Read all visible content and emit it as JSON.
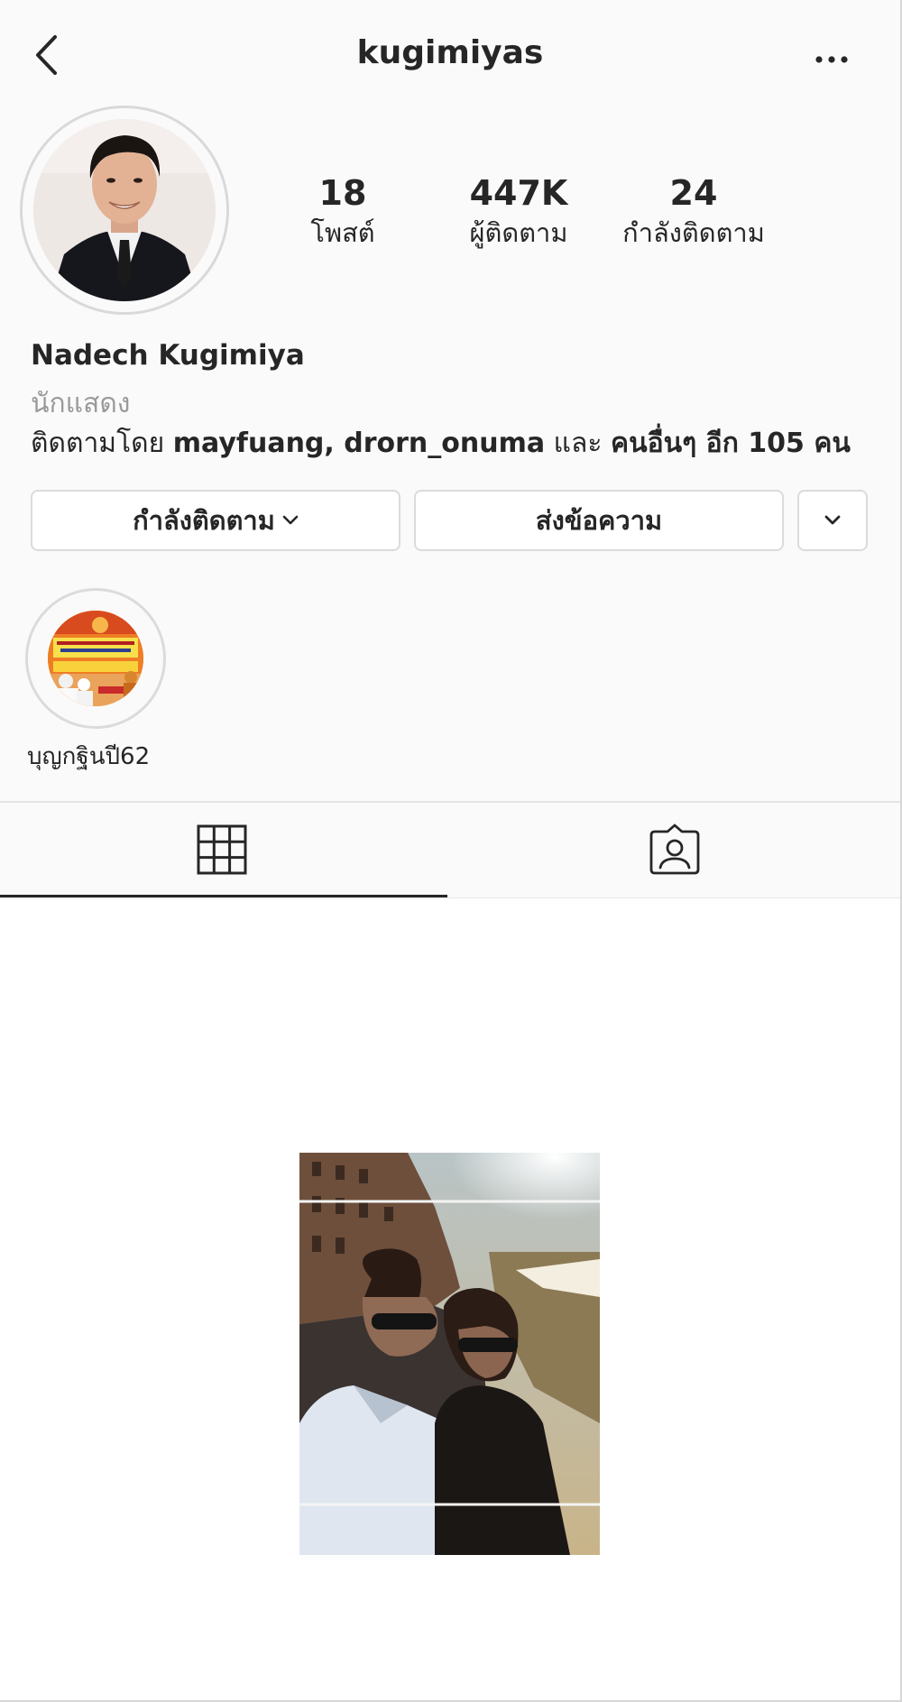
{
  "header": {
    "username": "kugimiyas",
    "back_icon": "chevron-left-icon",
    "more_icon": "more-horizontal-icon"
  },
  "stats": [
    {
      "value": "18",
      "label": "โพสต์"
    },
    {
      "value": "447K",
      "label": "ผู้ติดตาม"
    },
    {
      "value": "24",
      "label": "กำลังติดตาม"
    }
  ],
  "profile": {
    "full_name": "Nadech Kugimiya",
    "category": "นักแสดง",
    "followed_by_prefix": "ติดตามโดย ",
    "followed_by_names": "mayfuang, drorn_onuma",
    "followed_by_middle": " และ ",
    "followed_by_others": "คนอื่นๆ อีก 105 คน"
  },
  "actions": {
    "following_label": "กำลังติดตาม",
    "message_label": "ส่งข้อความ",
    "suggest_icon": "chevron-down-icon"
  },
  "highlights": [
    {
      "label": "บุญกฐินปี62"
    }
  ],
  "tabs": [
    {
      "icon": "grid-icon",
      "active": true
    },
    {
      "icon": "tagged-icon",
      "active": false
    }
  ],
  "colors": {
    "background": "#fafafa",
    "text": "#262626",
    "secondary_text": "#9a9a9a",
    "border": "#dbdbdb"
  }
}
